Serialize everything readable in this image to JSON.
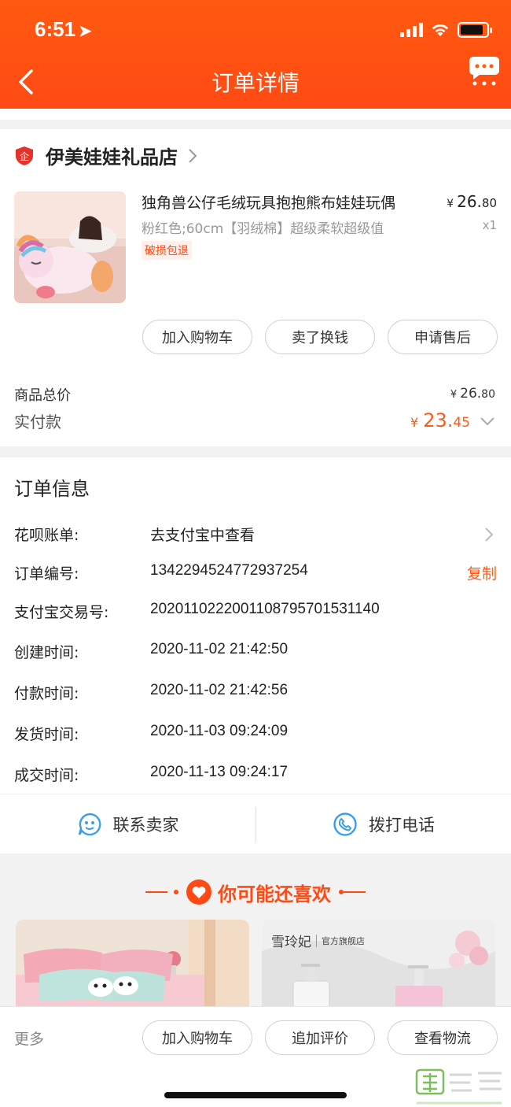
{
  "status_bar": {
    "time": "6:51"
  },
  "header": {
    "title": "订单详情"
  },
  "shop": {
    "name": "伊美娃娃礼品店",
    "product": {
      "title": "独角兽公仔毛绒玩具抱抱熊布娃娃玩偶",
      "sku": "粉红色;60cm【羽绒棉】超级柔软超级值",
      "tag": "破损包退",
      "currency": "¥",
      "price_int": "26.",
      "price_dec": "80",
      "qty": "x1"
    },
    "actions": [
      "加入购物车",
      "卖了换钱",
      "申请售后"
    ],
    "total_label": "商品总价",
    "total_currency": "¥",
    "total_int": "26.",
    "total_dec": "80",
    "paid_label": "实付款",
    "paid_currency": "¥",
    "paid_int": "23.",
    "paid_dec": "45"
  },
  "order_info": {
    "title": "订单信息",
    "rows": [
      {
        "key": "花呗账单:",
        "value": "去支付宝中查看"
      },
      {
        "key": "订单编号:",
        "value": "1342294524772937254",
        "action": "复制"
      },
      {
        "key": "支付宝交易号:",
        "value": "2020110222001108795701531140"
      },
      {
        "key": "创建时间:",
        "value": "2020-11-02 21:42:50"
      },
      {
        "key": "付款时间:",
        "value": "2020-11-02 21:42:56"
      },
      {
        "key": "发货时间:",
        "value": "2020-11-03 09:24:09"
      },
      {
        "key": "成交时间:",
        "value": "2020-11-13 09:24:17"
      }
    ]
  },
  "contact": {
    "seller": "联系卖家",
    "phone": "拨打电话"
  },
  "recommend": {
    "title": "你可能还喜欢",
    "brand": "雪玲妃",
    "brand_sub": "官方旗舰店"
  },
  "bottom_bar": {
    "more": "更多",
    "actions": [
      "加入购物车",
      "追加评价",
      "查看物流"
    ]
  },
  "colors": {
    "accent": "#ff4a14",
    "header": "#ff5a10"
  }
}
